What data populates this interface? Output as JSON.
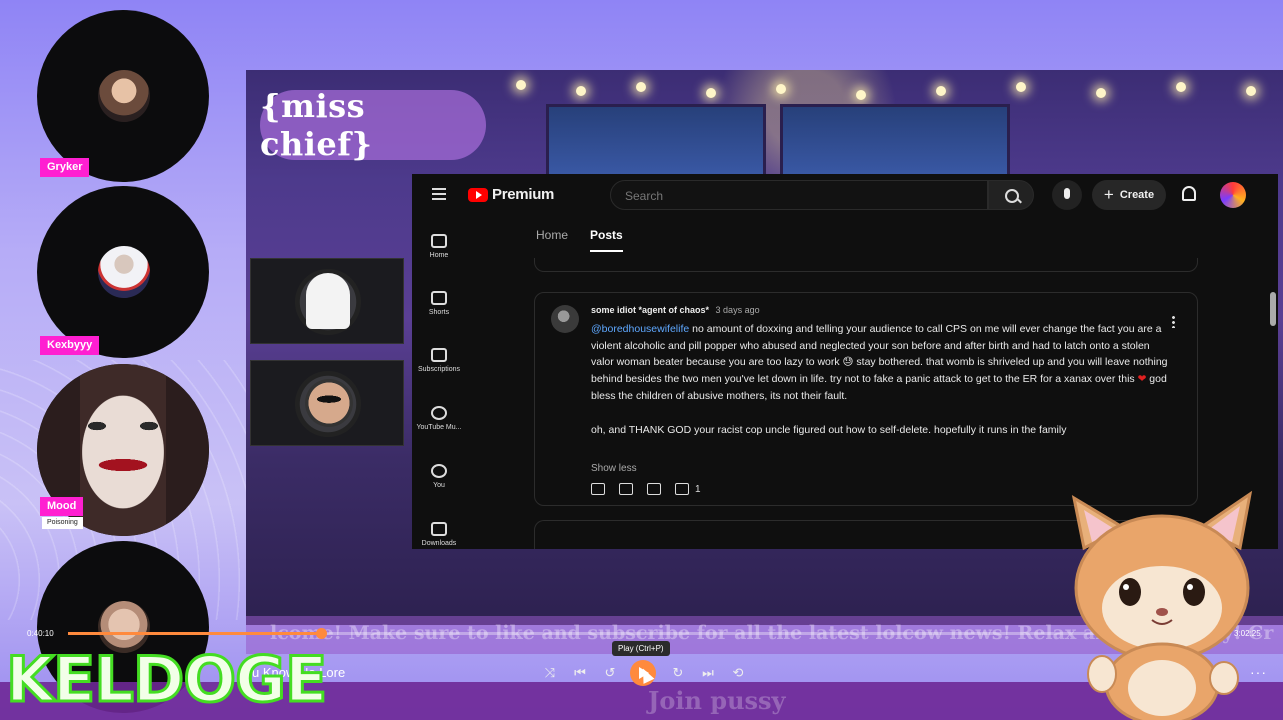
{
  "participants": [
    {
      "name": "Gryker",
      "subtitle": ""
    },
    {
      "name": "Kexbyyy",
      "subtitle": ""
    },
    {
      "name": "Mood",
      "subtitle": "Poisoning"
    },
    {
      "name": "",
      "subtitle": ""
    }
  ],
  "stage": {
    "logo": "{miss chief}"
  },
  "youtube": {
    "brand": "Premium",
    "search_placeholder": "Search",
    "create_label": "Create",
    "sidebar": [
      {
        "label": "Home",
        "icon": "home-icon"
      },
      {
        "label": "Shorts",
        "icon": "shorts-icon"
      },
      {
        "label": "Subscriptions",
        "icon": "subscriptions-icon"
      },
      {
        "label": "YouTube Mu...",
        "icon": "youtube-music-icon"
      },
      {
        "label": "You",
        "icon": "you-icon"
      },
      {
        "label": "Downloads",
        "icon": "download-icon"
      }
    ],
    "tabs": [
      {
        "label": "Home",
        "active": false
      },
      {
        "label": "Posts",
        "active": true
      }
    ],
    "post": {
      "author": "some idiot *agent of chaos*",
      "time": "3 days ago",
      "mention": "@boredhousewifelife",
      "body1": " no amount of doxxing and telling your audience to call CPS on me will ever change the fact you are a violent alcoholic and pill popper who abused and neglected your son before and after birth and had to latch onto a stolen valor woman beater because you are too lazy to work 😓 stay bothered. that womb is shriveled up and you will leave nothing behind besides the two men you've let down in life. try not to fake a panic attack to get to the ER for a xanax over this ",
      "heart": "❤",
      "body1_end": " god bless the children of abusive mothers, its not their fault.",
      "body2": "oh, and THANK GOD your racist cop uncle figured out how to self-delete. hopefully it runs in the family",
      "show_less": "Show less",
      "reply_count": "1"
    }
  },
  "ticker": "lcome! Make sure to like and subscribe for all the latest lolcow news! Relax and get comfy! Cr",
  "bottom_banner": "Join pussy",
  "player": {
    "elapsed": "0:40:10",
    "total": "3:02:25",
    "progress": 0.22,
    "track_title": "u Know No Lore",
    "tooltip": "Play (Ctrl+P)",
    "accent_color": "#ff8a3d",
    "controls": [
      "shuffle-icon",
      "previous-icon",
      "rewind-10-icon",
      "play-icon",
      "forward-30-icon",
      "next-icon",
      "repeat-icon"
    ]
  },
  "brand": "KELDOGE"
}
